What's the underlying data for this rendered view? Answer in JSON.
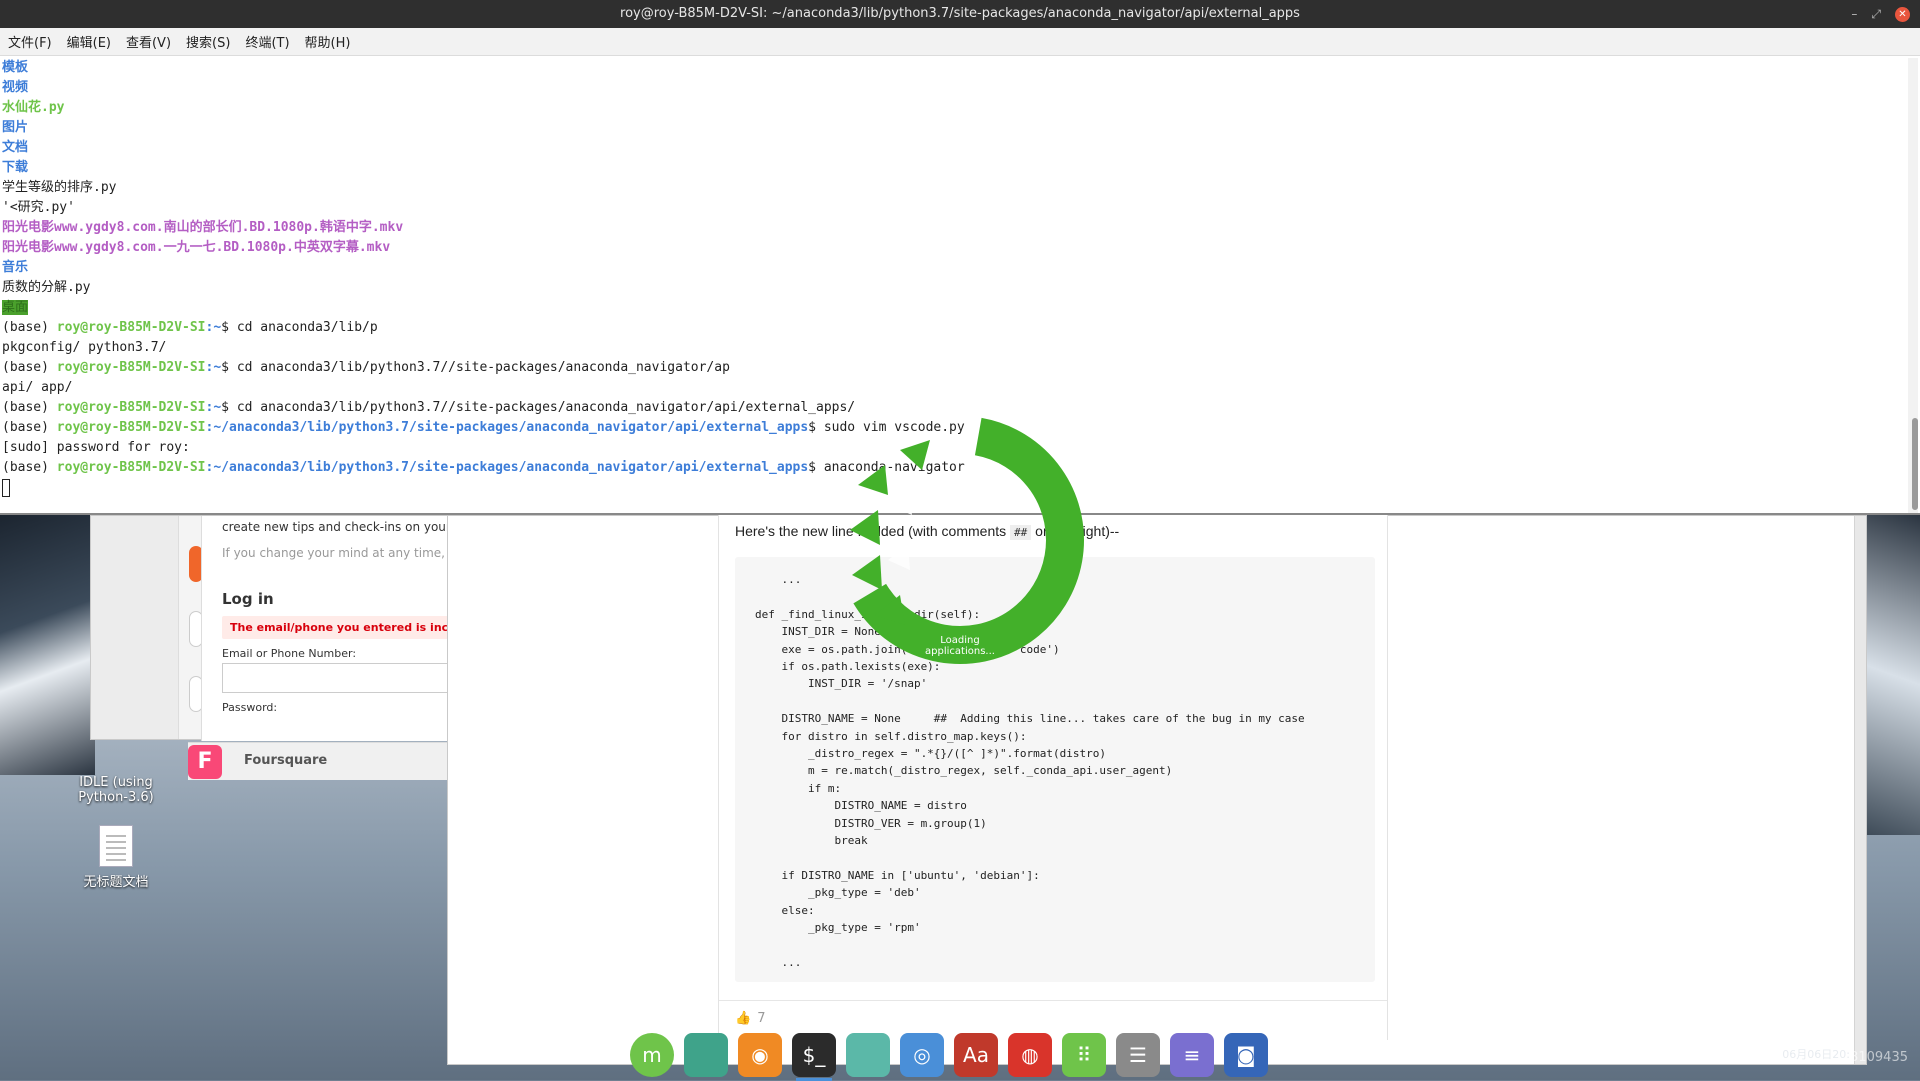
{
  "terminal": {
    "title": "roy@roy-B85M-D2V-SI: ~/anaconda3/lib/python3.7/site-packages/anaconda_navigator/api/external_apps",
    "menu": [
      "文件(F)",
      "编辑(E)",
      "查看(V)",
      "搜索(S)",
      "终端(T)",
      "帮助(H)"
    ],
    "listing": [
      {
        "text": "模板",
        "kind": "dir"
      },
      {
        "text": "视频",
        "kind": "dir"
      },
      {
        "text": "水仙花.py",
        "kind": "py"
      },
      {
        "text": "图片",
        "kind": "dir"
      },
      {
        "text": "文档",
        "kind": "dir"
      },
      {
        "text": "下载",
        "kind": "dir"
      },
      {
        "text": "学生等级的排序.py",
        "kind": "plain"
      },
      {
        "text": "'<研究.py'",
        "kind": "plain"
      },
      {
        "text": "阳光电影www.ygdy8.com.南山的部长们.BD.1080p.韩语中字.mkv",
        "kind": "mkv"
      },
      {
        "text": "阳光电影www.ygdy8.com.一九一七.BD.1080p.中英双字幕.mkv",
        "kind": "mkv"
      },
      {
        "text": "音乐",
        "kind": "dir"
      },
      {
        "text": "质数的分解.py",
        "kind": "plain"
      },
      {
        "text": "桌面",
        "kind": "hl"
      }
    ],
    "commands": [
      {
        "prefix": "(base) ",
        "user": "roy@roy-B85M-D2V-SI",
        "path": ":~",
        "cmd": "$ cd anaconda3/lib/p"
      },
      {
        "plain": "pkgconfig/ python3.7/"
      },
      {
        "prefix": "(base) ",
        "user": "roy@roy-B85M-D2V-SI",
        "path": ":~",
        "cmd": "$ cd anaconda3/lib/python3.7//site-packages/anaconda_navigator/ap"
      },
      {
        "plain": "api/ app/"
      },
      {
        "prefix": "(base) ",
        "user": "roy@roy-B85M-D2V-SI",
        "path": ":~",
        "cmd": "$ cd anaconda3/lib/python3.7//site-packages/anaconda_navigator/api/external_apps/"
      },
      {
        "prefix": "(base) ",
        "user": "roy@roy-B85M-D2V-SI",
        "path": ":~/anaconda3/lib/python3.7/site-packages/anaconda_navigator/api/external_apps",
        "cmd": "$ sudo vim vscode.py"
      },
      {
        "plain": "[sudo] password for roy:"
      },
      {
        "prefix": "(base) ",
        "user": "roy@roy-B85M-D2V-SI",
        "path": ":~/anaconda3/lib/python3.7/site-packages/anaconda_navigator/api/external_apps",
        "cmd": "$ anaconda-navigator"
      }
    ]
  },
  "splash": {
    "text": "Loading applications..."
  },
  "browser_left": {
    "tip": "create new tips and check-ins on your",
    "note": "If you change your mind at any time, y",
    "login": "Log in",
    "error": "The email/phone you entered is incorrect. F",
    "email_label": "Email or Phone Number:",
    "password_label": "Password:",
    "foursquare": "Foursquare",
    "foursquare_glyph": "F"
  },
  "post": {
    "line_before": "Here's the new line I added (with comments",
    "code_tag": "##",
    "line_after": "on the right)--",
    "code": "    ...\n\ndef _find_linux_install_dir(self):\n    INST_DIR = None\n    exe = os.path.join('/snap', 'bin', 'code')\n    if os.path.lexists(exe):\n        INST_DIR = '/snap'\n\n    DISTRO_NAME = None     ##  Adding this line... takes care of the bug in my case\n    for distro in self.distro_map.keys():\n        _distro_regex = \".*{}/([^ ]*)\".format(distro)\n        m = re.match(_distro_regex, self._conda_api.user_agent)\n        if m:\n            DISTRO_NAME = distro\n            DISTRO_VER = m.group(1)\n            break\n\n    if DISTRO_NAME in ['ubuntu', 'debian']:\n        _pkg_type = 'deb'\n    else:\n        _pkg_type = 'rpm'\n\n    ...",
    "likes": "7"
  },
  "desktop": {
    "idle_label": "IDLE (using Python-3.6)",
    "doc_label": "无标题文档"
  },
  "dock": [
    {
      "name": "mint-menu-icon",
      "color": "#6fc44a",
      "glyph": "m"
    },
    {
      "name": "files-icon",
      "color": "#3fa38a",
      "glyph": ""
    },
    {
      "name": "firefox-icon",
      "color": "#f08a24",
      "glyph": "◉"
    },
    {
      "name": "terminal-icon",
      "color": "#2b2b2b",
      "glyph": "$_"
    },
    {
      "name": "folder-icon",
      "color": "#5bb8a8",
      "glyph": ""
    },
    {
      "name": "chromium-icon",
      "color": "#4a8fd8",
      "glyph": "◎"
    },
    {
      "name": "dictionary-icon",
      "color": "#c0392b",
      "glyph": "Aa"
    },
    {
      "name": "netease-music-icon",
      "color": "#d9342b",
      "glyph": "◍"
    },
    {
      "name": "app-grid-icon",
      "color": "#6fc44a",
      "glyph": "⠿"
    },
    {
      "name": "settings-icon",
      "color": "#8a8a8a",
      "glyph": "☰"
    },
    {
      "name": "text-editor-icon",
      "color": "#7a6fd0",
      "glyph": "≡"
    },
    {
      "name": "screenshot-icon",
      "color": "#3566b8",
      "glyph": "◙"
    }
  ],
  "tray": {
    "date": "06月06日20:"
  },
  "watermark": "https://blog.csdn.net/qq_43109435"
}
